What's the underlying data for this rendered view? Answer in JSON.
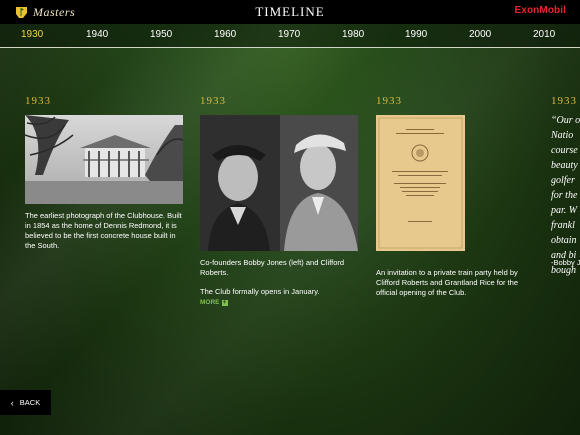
{
  "header": {
    "brand": "Masters",
    "title": "TIMELINE",
    "sponsor_prefix": "E",
    "sponsor_x": "x",
    "sponsor_suffix": "onMobil"
  },
  "years": [
    "1930",
    "1940",
    "1950",
    "1960",
    "1970",
    "1980",
    "1990",
    "2000",
    "2010"
  ],
  "active_year": "1930",
  "entries": [
    {
      "year": "1933",
      "caption": "The earliest photograph of the Clubhouse. Built in 1854 as the home of Dennis Redmond, it is believed to be the first concrete house built in the South."
    },
    {
      "year": "1933",
      "caption": "Co-founders Bobby Jones (left) and Clifford Roberts.",
      "caption2": "The Club formally opens in January.",
      "more": "MORE"
    },
    {
      "year": "1933",
      "caption": "An invitation to a private train party held by Clifford Roberts and Grantland Rice for the official opening of the Club.",
      "doc_lines": [
        "OFFICIAL PROGRAM",
        "AUGUSTA NATIONAL GOLF CLUB",
        "AUGUSTA NATIONAL GOLF CLUB",
        "PENNSYLVANIA STATION",
        "NEW YORK"
      ]
    },
    {
      "year": "1933",
      "quote_lines": [
        "“Our o",
        "Natio",
        "course",
        "beauty",
        "golfer",
        "for the",
        "par. W",
        "frankl",
        "obtain",
        "and bi",
        "bough"
      ],
      "attribution": "-Bobby J"
    }
  ],
  "back": {
    "label": "BACK"
  },
  "colors": {
    "accent_year": "#f2d64a",
    "entry_year": "#d9b93a",
    "sponsor": "#e4242e",
    "more": "#7fc04a"
  }
}
